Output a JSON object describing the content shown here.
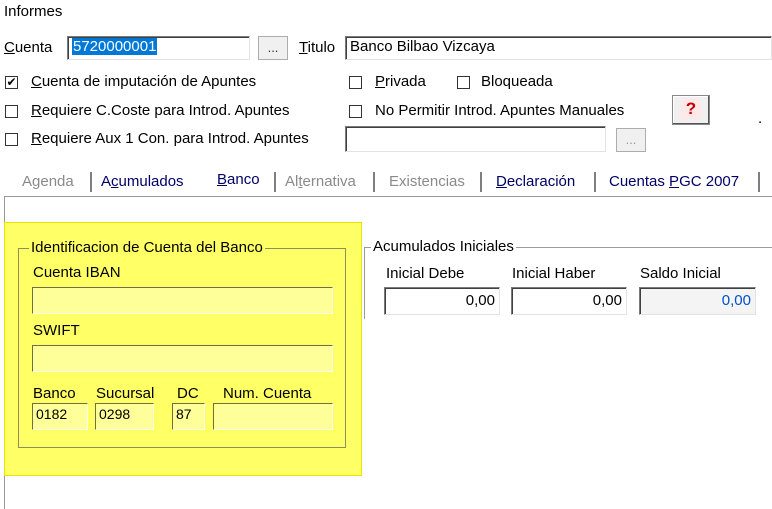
{
  "window": {
    "title": "Informes"
  },
  "header": {
    "cuenta_label": "Cuenta",
    "cuenta_value": "5720000001",
    "browse_label": "...",
    "titulo_label": "Titulo",
    "titulo_value": "Banco Bilbao Vizcaya",
    "dot": "."
  },
  "checks": {
    "imputacion": {
      "label": "Cuenta de imputación de Apuntes",
      "checked": true,
      "mark": "✔"
    },
    "privada": {
      "label": "Privada",
      "checked": false
    },
    "bloqueada": {
      "label": "Bloqueada",
      "checked": false
    },
    "ccoste": {
      "label": "Requiere C.Coste para Introd. Apuntes",
      "checked": false
    },
    "no_manuales": {
      "label": "No Permitir Introd. Apuntes Manuales",
      "checked": false
    },
    "aux1": {
      "label": "Requiere Aux 1 Con. para Introd. Apuntes",
      "checked": false,
      "value": "",
      "browse_label": "..."
    }
  },
  "help_button": {
    "icon": "question-icon",
    "glyph": "?",
    "color": "#c00000"
  },
  "tabs": [
    {
      "label": "Agenda",
      "state": "disabled"
    },
    {
      "label": "Acumulados",
      "state": "enabled"
    },
    {
      "label": "Banco",
      "state": "selected"
    },
    {
      "label": "Alternativa",
      "state": "disabled"
    },
    {
      "label": "Existencias",
      "state": "disabled"
    },
    {
      "label": "Declaración",
      "state": "enabled"
    },
    {
      "label": "Cuentas PGC 2007",
      "state": "enabled"
    }
  ],
  "bank_group": {
    "title": "Identificacion de Cuenta del Banco",
    "iban_label": "Cuenta IBAN",
    "iban_value": "",
    "swift_label": "SWIFT",
    "swift_value": "",
    "banco_label": "Banco",
    "banco_value": "0182",
    "sucursal_label": "Sucursal",
    "sucursal_value": "0298",
    "dc_label": "DC",
    "dc_value": "87",
    "numcuenta_label": "Num. Cuenta",
    "numcuenta_value": "",
    "highlight_color": "#ffff66"
  },
  "acumulados_group": {
    "title": "Acumulados Iniciales",
    "debe_label": "Inicial Debe",
    "debe_value": "0,00",
    "haber_label": "Inicial Haber",
    "haber_value": "0,00",
    "saldo_label": "Saldo Inicial",
    "saldo_value": "0,00",
    "saldo_color": "#0050c8"
  }
}
